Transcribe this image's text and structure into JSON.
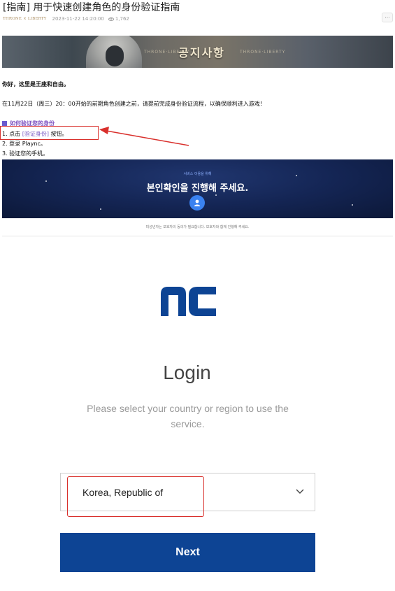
{
  "post": {
    "title": "[指南] 用于快速创建角色的身份验证指南",
    "logo_text": "THRONE × LIBERTY",
    "date": "2023-11-22 14:20:00",
    "views": "1,762",
    "more_label": "···"
  },
  "banner": {
    "text": "공지사항",
    "deco_left": "THRONE·LIBERTY",
    "deco_right": "THRONE·LIBERTY"
  },
  "body": {
    "greeting": "你好，这里是王座和自由。",
    "notice": "在11月22日（周三）20：00开始的前期角色创建之前，请提前完成身份验证流程，以确保顺利进入游戏！",
    "howto_heading": "如何验证您的身份",
    "step1_prefix": "1. 点击 ",
    "step1_link": "[验证身份]",
    "step1_suffix": " 按钮。",
    "step2": "2. 登录 Plaync。",
    "step3": "3. 验证您的手机。"
  },
  "verify_banner": {
    "small_text": "서비스 이용을 위해",
    "big_text": "본인확인을 진행해 주세요.",
    "caption": "미성년자는 보호자의 동의가 필요합니다. 보호자와 함께 진행해 주세요."
  },
  "login": {
    "title": "Login",
    "subtitle": "Please select your country or region to use the service.",
    "country_value": "Korea, Republic of",
    "next_label": "Next"
  },
  "colors": {
    "accent_navy": "#0d4494",
    "highlight_red": "#d9302c",
    "link_purple": "#7a5bc4"
  }
}
